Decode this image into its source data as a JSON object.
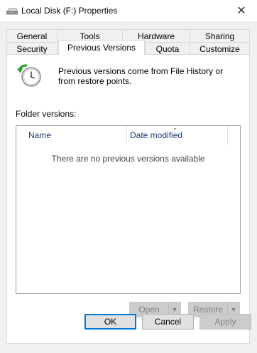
{
  "window": {
    "title": "Local Disk (F:) Properties",
    "close_glyph": "✕",
    "icon": "drive-icon"
  },
  "tabs_row1": [
    "General",
    "Tools",
    "Hardware",
    "Sharing"
  ],
  "tabs_row2": [
    "Security",
    "Previous Versions",
    "Quota",
    "Customize"
  ],
  "active_tab": "Previous Versions",
  "panel": {
    "icon": "clock-restore-icon",
    "info": "Previous versions come from File History or from restore points.",
    "folder_versions_label": "Folder versions:",
    "list": {
      "columns": [
        "Name",
        "Date modified"
      ],
      "sort_indicator": "⌄",
      "empty_message": "There are no previous versions available"
    },
    "open_label": "Open",
    "restore_label": "Restore",
    "dropdown_glyph": "▼"
  },
  "buttons": {
    "ok": "OK",
    "cancel": "Cancel",
    "apply": "Apply"
  },
  "colors": {
    "dialog_bg": "#f0f0f0",
    "column_header_text": "#1e3a6f",
    "default_button_border": "#0078d7",
    "disabled_text": "#838383"
  }
}
